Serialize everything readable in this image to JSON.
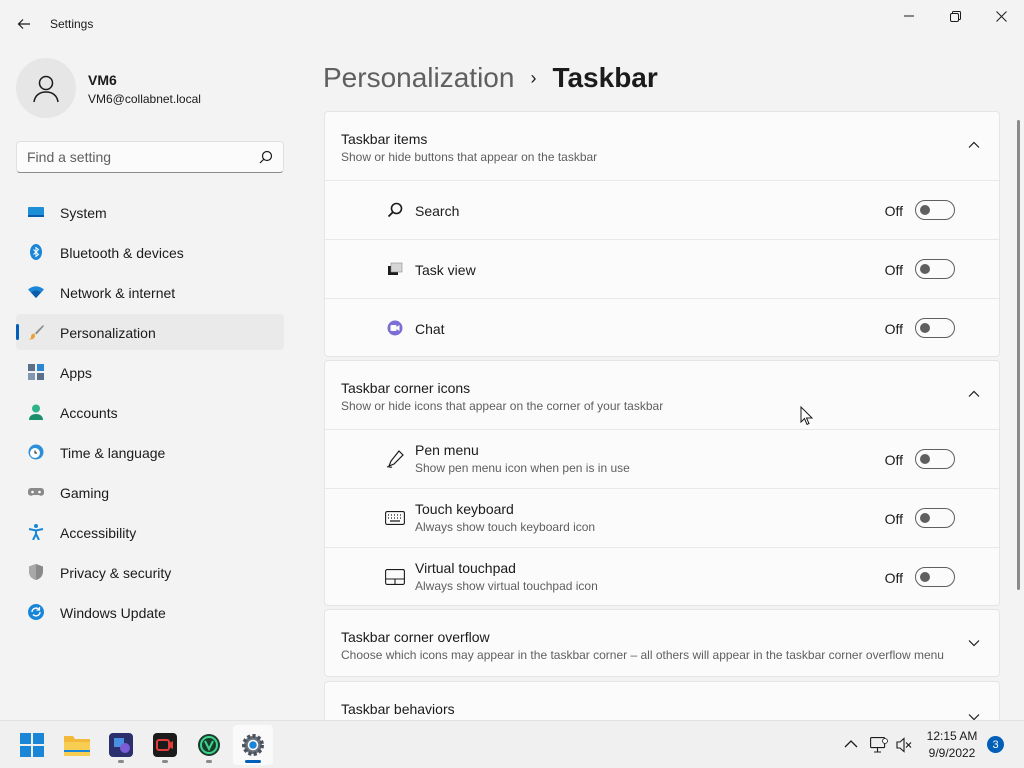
{
  "window": {
    "app_title": "Settings",
    "back_icon": "back-arrow-icon",
    "controls": [
      "minimize-icon",
      "maximize-icon",
      "close-icon"
    ]
  },
  "profile": {
    "name": "VM6",
    "email": "VM6@collabnet.local"
  },
  "search": {
    "placeholder": "Find a setting",
    "value": ""
  },
  "sidebar": {
    "items": [
      {
        "label": "System",
        "icon": "system-icon"
      },
      {
        "label": "Bluetooth & devices",
        "icon": "bluetooth-icon"
      },
      {
        "label": "Network & internet",
        "icon": "wifi-icon"
      },
      {
        "label": "Personalization",
        "icon": "brush-icon",
        "selected": true
      },
      {
        "label": "Apps",
        "icon": "apps-icon"
      },
      {
        "label": "Accounts",
        "icon": "accounts-icon"
      },
      {
        "label": "Time & language",
        "icon": "time-language-icon"
      },
      {
        "label": "Gaming",
        "icon": "gamepad-icon"
      },
      {
        "label": "Accessibility",
        "icon": "accessibility-icon"
      },
      {
        "label": "Privacy & security",
        "icon": "shield-icon"
      },
      {
        "label": "Windows Update",
        "icon": "update-icon"
      }
    ]
  },
  "breadcrumb": {
    "parent": "Personalization",
    "separator": "›",
    "current": "Taskbar"
  },
  "sections": {
    "taskbar_items": {
      "title": "Taskbar items",
      "description": "Show or hide buttons that appear on the taskbar",
      "expanded": true,
      "rows": [
        {
          "label": "Search",
          "state": "Off",
          "icon": "search-icon"
        },
        {
          "label": "Task view",
          "state": "Off",
          "icon": "task-view-icon"
        },
        {
          "label": "Chat",
          "state": "Off",
          "icon": "chat-icon"
        }
      ]
    },
    "corner_icons": {
      "title": "Taskbar corner icons",
      "description": "Show or hide icons that appear on the corner of your taskbar",
      "expanded": true,
      "rows": [
        {
          "label": "Pen menu",
          "sub": "Show pen menu icon when pen is in use",
          "state": "Off",
          "icon": "pen-icon"
        },
        {
          "label": "Touch keyboard",
          "sub": "Always show touch keyboard icon",
          "state": "Off",
          "icon": "keyboard-icon"
        },
        {
          "label": "Virtual touchpad",
          "sub": "Always show virtual touchpad icon",
          "state": "Off",
          "icon": "touchpad-icon"
        }
      ]
    },
    "corner_overflow": {
      "title": "Taskbar corner overflow",
      "description": "Choose which icons may appear in the taskbar corner – all others will appear in the taskbar corner overflow menu",
      "expanded": false
    },
    "behaviors": {
      "title": "Taskbar behaviors",
      "expanded": false
    }
  },
  "taskbar": {
    "apps": [
      "windows-start-icon",
      "file-explorer-icon",
      "remote-desktop-icon",
      "screen-recorder-icon",
      "vpn-client-icon",
      "settings-gear-icon"
    ],
    "tray_icons": [
      "chevron-up-icon",
      "network-icon",
      "volume-muted-icon"
    ],
    "time": "12:15 AM",
    "date": "9/9/2022",
    "notifications": "3"
  },
  "colors": {
    "accent": "#005fb8",
    "background": "#f3f3f3",
    "card": "#fbfbfb"
  }
}
